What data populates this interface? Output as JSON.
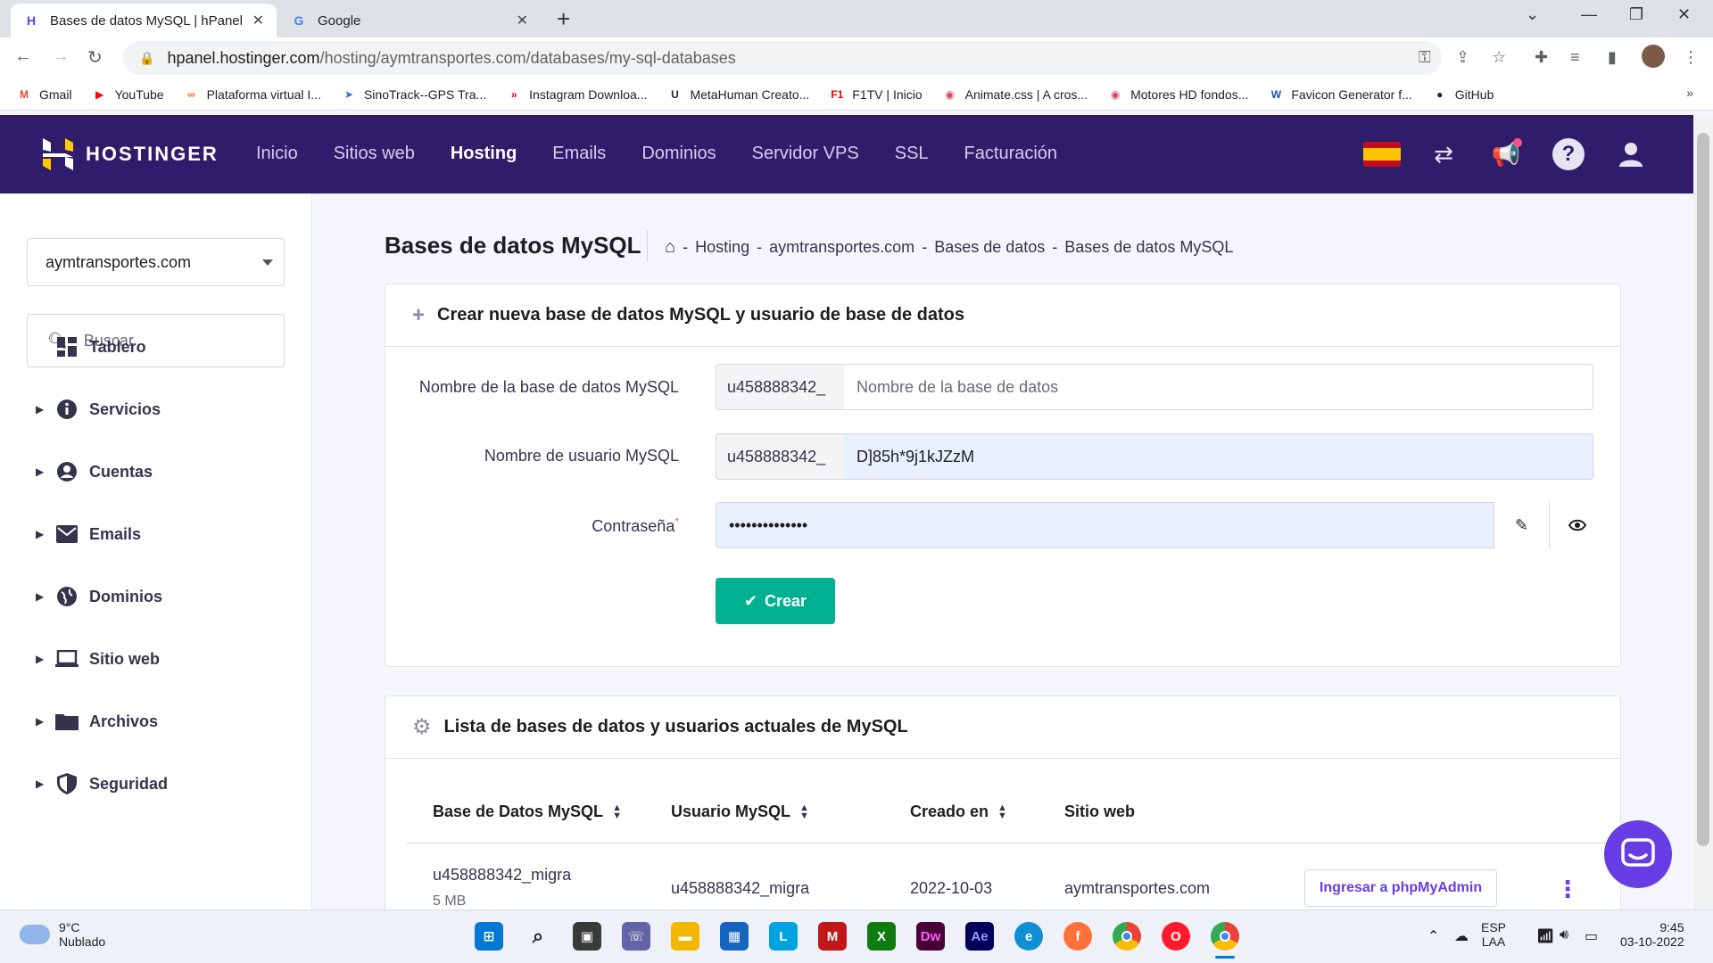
{
  "browser": {
    "tabs": [
      {
        "title": "Bases de datos MySQL | hPanel",
        "favicon": "H",
        "active": true
      },
      {
        "title": "Google",
        "favicon": "G",
        "active": false
      }
    ],
    "url_host": "hpanel.hostinger.com",
    "url_path": "/hosting/aymtransportes.com/databases/my-sql-databases",
    "bookmarks": [
      {
        "label": "Gmail",
        "icon": "M",
        "color": "#ea4335"
      },
      {
        "label": "YouTube",
        "icon": "▶",
        "color": "#ff0000"
      },
      {
        "label": "Plataforma virtual I...",
        "icon": "∞",
        "color": "#ff5a1f"
      },
      {
        "label": "SinoTrack--GPS Tra...",
        "icon": "➤",
        "color": "#1a73e8"
      },
      {
        "label": "Instagram Downloa...",
        "icon": "»",
        "color": "#e0001a"
      },
      {
        "label": "MetaHuman Creato...",
        "icon": "U",
        "color": "#222222"
      },
      {
        "label": "F1TV | Inicio",
        "icon": "F1",
        "color": "#e10600"
      },
      {
        "label": "Animate.css | A cros...",
        "icon": "◉",
        "color": "#e0445c"
      },
      {
        "label": "Motores HD fondos...",
        "icon": "◉",
        "color": "#e0445c"
      },
      {
        "label": "Favicon Generator f...",
        "icon": "W",
        "color": "#1a4fd8"
      },
      {
        "label": "GitHub",
        "icon": "●",
        "color": "#24292f"
      }
    ],
    "bookmarks_more": "»"
  },
  "header": {
    "brand": "HOSTINGER",
    "nav": [
      {
        "label": "Inicio",
        "active": false
      },
      {
        "label": "Sitios web",
        "active": false
      },
      {
        "label": "Hosting",
        "active": true
      },
      {
        "label": "Emails",
        "active": false
      },
      {
        "label": "Dominios",
        "active": false
      },
      {
        "label": "Servidor VPS",
        "active": false
      },
      {
        "label": "SSL",
        "active": false
      },
      {
        "label": "Facturación",
        "active": false
      }
    ]
  },
  "sidebar": {
    "domain": "aymtransportes.com",
    "search_placeholder": "Buscar",
    "items": [
      {
        "label": "Tablero",
        "icon": "dashboard-icon",
        "expandable": false
      },
      {
        "label": "Servicios",
        "icon": "info-icon",
        "expandable": true
      },
      {
        "label": "Cuentas",
        "icon": "account-icon",
        "expandable": true
      },
      {
        "label": "Emails",
        "icon": "mail-icon",
        "expandable": true
      },
      {
        "label": "Dominios",
        "icon": "globe-icon",
        "expandable": true
      },
      {
        "label": "Sitio web",
        "icon": "laptop-icon",
        "expandable": true
      },
      {
        "label": "Archivos",
        "icon": "folder-icon",
        "expandable": true
      },
      {
        "label": "Seguridad",
        "icon": "shield-icon",
        "expandable": true
      }
    ]
  },
  "main": {
    "title": "Bases de datos MySQL",
    "breadcrumb": [
      "Hosting",
      "aymtransportes.com",
      "Bases de datos",
      "Bases de datos MySQL"
    ],
    "breadcrumb_sep": "-",
    "create_card": {
      "title": "Crear nueva base de datos MySQL y usuario de base de datos",
      "db_label": "Nombre de la base de datos MySQL",
      "db_prefix": "u458888342_",
      "db_placeholder": "Nombre de la base de datos",
      "user_label": "Nombre de usuario MySQL",
      "user_prefix": "u458888342_",
      "user_value": "D]85h*9j1kJZzM",
      "password_label": "Contraseña",
      "password_required_mark": "*",
      "password_value": "••••••••••••••",
      "create_button": "Crear"
    },
    "list_card": {
      "title": "Lista de bases de datos y usuarios actuales de MySQL",
      "columns": [
        "Base de Datos MySQL",
        "Usuario MySQL",
        "Creado en",
        "Sitio web"
      ],
      "rows": [
        {
          "database": "u458888342_migra",
          "size": "5 MB",
          "user": "u458888342_migra",
          "created": "2022-10-03",
          "website": "aymtransportes.com",
          "action": "Ingresar a phpMyAdmin"
        }
      ]
    }
  },
  "taskbar": {
    "temperature": "9°C",
    "weather": "Nublado",
    "lang_top": "ESP",
    "lang_bottom": "LAA",
    "time": "9:45",
    "date": "03-10-2022"
  },
  "colors": {
    "header_bg": "#2f1c6a",
    "accent": "#673de6",
    "create_button": "#00b090"
  }
}
